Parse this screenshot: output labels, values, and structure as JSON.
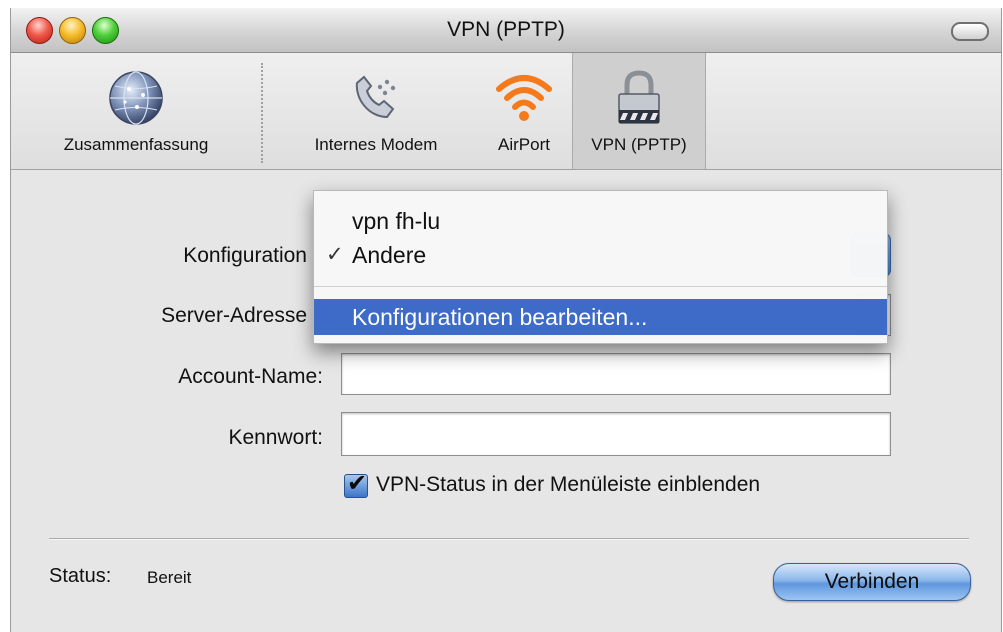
{
  "window": {
    "title": "VPN (PPTP)"
  },
  "toolbar": {
    "items": [
      {
        "label": "Zusammenfassung",
        "icon": "globe-icon"
      },
      {
        "label": "Internes Modem",
        "icon": "phone-icon"
      },
      {
        "label": "AirPort",
        "icon": "wifi-icon"
      },
      {
        "label": "VPN (PPTP)",
        "icon": "lock-icon",
        "selected": true
      }
    ]
  },
  "form": {
    "konfiguration_label": "Konfiguration",
    "server_label": "Server-Adresse",
    "account_label": "Account-Name:",
    "account_value": "",
    "kennwort_label": "Kennwort:",
    "kennwort_value": "",
    "vpn_status_checkbox_label": "VPN-Status in der Menüleiste einblenden",
    "vpn_status_checked": true
  },
  "popup_menu": {
    "items": [
      "vpn fh-lu",
      "Andere",
      "Konfigurationen bearbeiten..."
    ],
    "checked_item": "Andere",
    "check_mark": "✓",
    "highlighted_item": "Konfigurationen bearbeiten..."
  },
  "status": {
    "label": "Status:",
    "value": "Bereit"
  },
  "buttons": {
    "connect_label": "Verbinden"
  },
  "colors": {
    "selection_blue": "#3d6bc7",
    "aqua_blue": "#5f97dd",
    "window_gray": "#e6e6e6"
  }
}
